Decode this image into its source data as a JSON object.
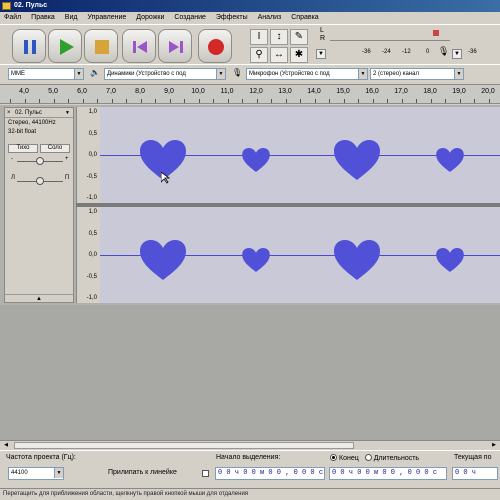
{
  "window": {
    "title": "02. Пульс"
  },
  "menu": [
    "Файл",
    "Правка",
    "Вид",
    "Управление",
    "Дорожки",
    "Создание",
    "Эффекты",
    "Анализ",
    "Справка"
  ],
  "transport": {
    "pause": "pause-icon",
    "play": "play-icon",
    "stop": "stop-icon",
    "skip_start": "skip-start-icon",
    "skip_end": "skip-end-icon",
    "record": "record-icon"
  },
  "tools": {
    "select": "I",
    "envelope": "↕",
    "draw": "✎",
    "zoom": "⚲",
    "timeshift": "↔",
    "multi": "✱"
  },
  "meter": {
    "L": "L",
    "R": "R",
    "scale": [
      "-36",
      "-24",
      "-12",
      "0"
    ],
    "scale2": [
      "-36"
    ]
  },
  "devices": {
    "host": "MME",
    "output": "Динамики (Устройство с под",
    "input": "Микрофон (Устройство с под",
    "channels": "2 (стерео) канал"
  },
  "ruler": {
    "labels": [
      "4,0",
      "5,0",
      "6,0",
      "7,0",
      "8,0",
      "9,0",
      "10,0",
      "11,0",
      "12,0",
      "13,0",
      "14,0",
      "15,0",
      "16,0",
      "17,0",
      "18,0",
      "19,0",
      "20,0"
    ]
  },
  "track": {
    "close": "×",
    "name": "02. Пульс",
    "info1": "Стерео, 44100Hz",
    "info2": "32-bit float",
    "mute": "Тихо",
    "solo": "Соло",
    "gain_minus": "-",
    "gain_plus": "+",
    "pan_left": "Л",
    "pan_right": "П",
    "collapse": "▲"
  },
  "vscale": {
    "top": [
      "1,0",
      "0,5",
      "0,0",
      "-0,5",
      "-1,0"
    ],
    "bottom": [
      "1,0",
      "0,5",
      "0,0",
      "-0,5",
      "-1,0"
    ]
  },
  "selection": {
    "rate_label": "Частота проекта (Гц):",
    "rate_value": "44100",
    "snap_label": "Прилипать к линейке",
    "start_label": "Начало выделения:",
    "start_value": "0 0 ч 0 0 м 0 0 , 0 0 0 с",
    "end_option": "Конец",
    "length_option": "Длительность",
    "end_value": "0 0 ч 0 0 м 0 0 , 0 0 0 с",
    "pos_label": "Текущая по",
    "pos_value": "0 0 ч"
  },
  "status": "Перетащить для приближения области, щелкнуть правой кнопкой мыши для отдаления",
  "colors": {
    "waveform": "#5151d8",
    "wave_bg": "#c9c9d8",
    "titlebar": "#0a246a"
  }
}
